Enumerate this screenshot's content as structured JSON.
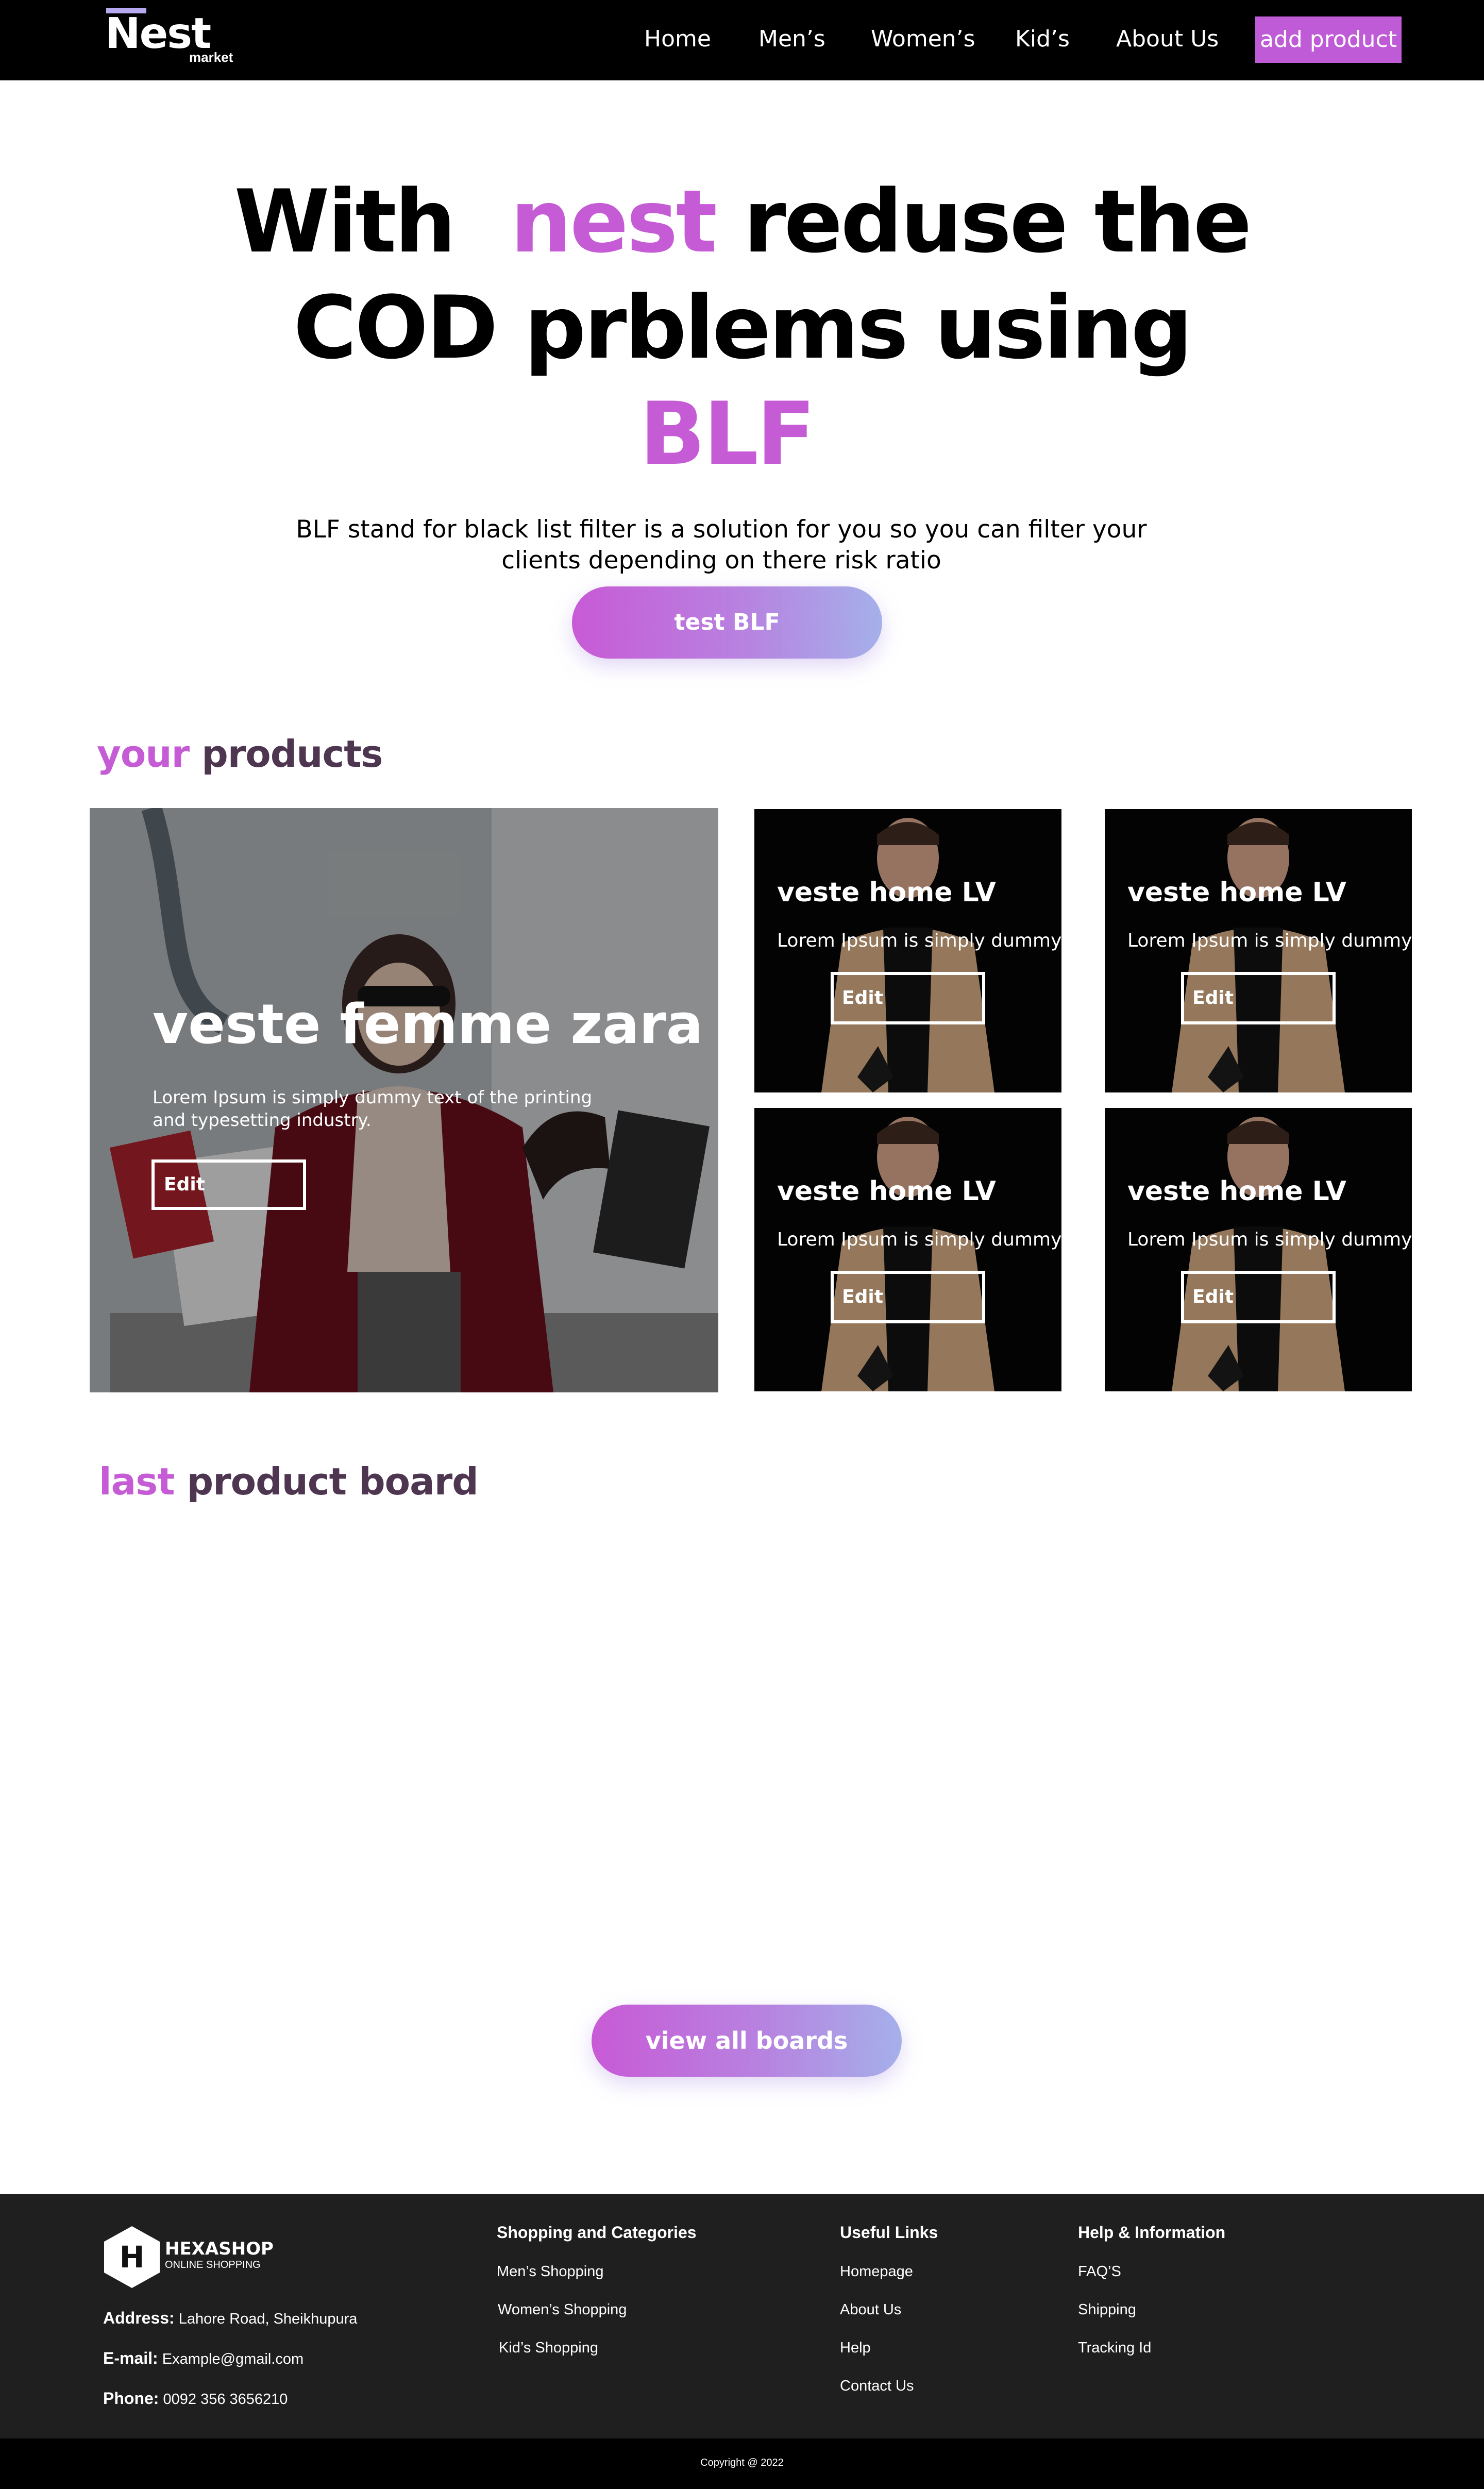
{
  "header": {
    "logo": {
      "main": "Nest",
      "sub": "market"
    },
    "nav": [
      "Home",
      "Men’s",
      "Women’s",
      "Kid’s",
      "About Us"
    ],
    "add_product_label": "add product"
  },
  "hero": {
    "line1_a": "With",
    "line1_b": "nest",
    "line1_c": "reduse the",
    "line2": "COD prblems using",
    "line3": "BLF",
    "sub1": "BLF stand for black list filter is a solution for you so you can filter your",
    "sub2": "clients depending on there risk ratio",
    "cta_label": "test BLF"
  },
  "products_section": {
    "title_accent": "your",
    "title_rest": "products",
    "featured": {
      "title": "veste femme zara",
      "desc1": "Lorem Ipsum is simply dummy text of the printing",
      "desc2": "and typesetting industry.",
      "edit_label": "Edit"
    },
    "items": [
      {
        "title": "veste home LV",
        "desc": "Lorem Ipsum is simply dummy",
        "edit_label": "Edit"
      },
      {
        "title": "veste home LV",
        "desc": "Lorem Ipsum is simply dummy",
        "edit_label": "Edit"
      },
      {
        "title": "veste home LV",
        "desc": "Lorem Ipsum is simply dummy",
        "edit_label": "Edit"
      },
      {
        "title": "veste home LV",
        "desc": "Lorem Ipsum is simply dummy",
        "edit_label": "Edit"
      }
    ]
  },
  "board_section": {
    "title_accent": "last",
    "title_rest": "product board",
    "cta_label": "view all boards"
  },
  "footer": {
    "brand": {
      "mark": "H",
      "name": "HEXASHOP",
      "tagline": "ONLINE SHOPPING"
    },
    "address_label": "Address:",
    "address": "Lahore Road, Sheikhupura",
    "email_label": "E-mail:",
    "email": "Example@gmail.com",
    "phone_label": "Phone:",
    "phone": "0092 356 3656210",
    "columns": [
      {
        "heading": "Shopping and Categories",
        "links": [
          "Men’s Shopping",
          "Women’s Shopping",
          "Kid’s Shopping"
        ]
      },
      {
        "heading": "Useful Links",
        "links": [
          "Homepage",
          "About Us",
          "Help",
          "Contact Us"
        ]
      },
      {
        "heading": "Help & Information",
        "links": [
          "FAQ’S",
          "Shipping",
          "Tracking Id"
        ]
      }
    ],
    "copyright": "Copyright @ 2022"
  },
  "colors": {
    "accent": "#c65bd6",
    "header_bg": "#000000",
    "footer_bg": "#1f1f1f",
    "section_title": "#4e3550"
  }
}
